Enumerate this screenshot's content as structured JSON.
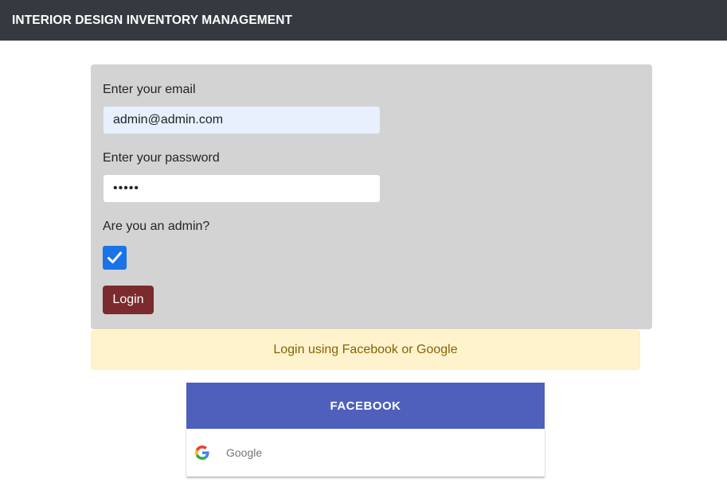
{
  "header": {
    "title": "INTERIOR DESIGN INVENTORY MANAGEMENT"
  },
  "login_form": {
    "email_label": "Enter your email",
    "email_value": "admin@admin.com",
    "password_label": "Enter your password",
    "password_value": "•••••",
    "admin_label": "Are you an admin?",
    "admin_checked": true,
    "login_label": "Login"
  },
  "social": {
    "alert_text": "Login using Facebook or Google",
    "facebook_label": "FACEBOOK",
    "google_label": "Google"
  },
  "colors": {
    "navbar": "#343a40",
    "card": "#d3d3d3",
    "login_button": "#7b2a2d",
    "checkbox": "#1a73e8",
    "alert_bg": "#fff3cd",
    "alert_text": "#856404",
    "facebook": "#4e60bc"
  },
  "icons": {
    "checkbox": "checkmark-icon",
    "google": "google-logo-icon"
  }
}
